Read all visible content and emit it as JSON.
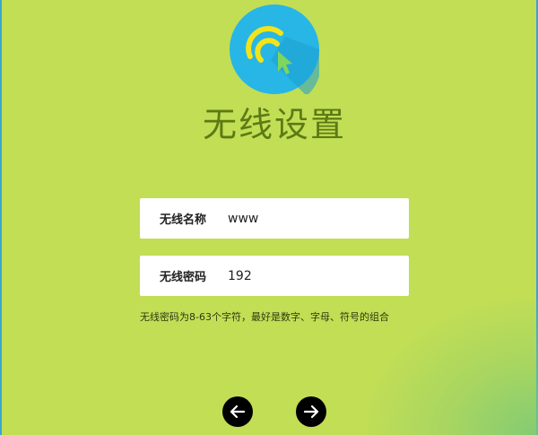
{
  "page": {
    "title": "无线设置",
    "hint": "无线密码为8-63个字符，最好是数字、字母、符号的组合"
  },
  "form": {
    "ssid": {
      "label": "无线名称",
      "value": "www"
    },
    "password": {
      "label": "无线密码",
      "value": "192"
    }
  },
  "nav": {
    "back_icon": "arrow-left-icon",
    "next_icon": "arrow-right-icon"
  },
  "colors": {
    "background": "#c2de55",
    "title": "#5c7a14",
    "logo_circle": "#27b6e6",
    "wifi_waves": "#f2e31b",
    "cursor": "#7ed65b"
  }
}
